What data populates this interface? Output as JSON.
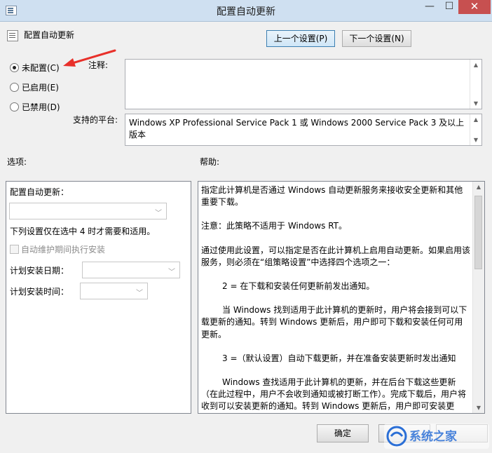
{
  "window": {
    "title": "配置自动更新",
    "close_glyph": "✕",
    "minimize_glyph": "—",
    "maximize_glyph": "☐"
  },
  "header": {
    "policy_name": "配置自动更新",
    "prev_button": "上一个设置(P)",
    "next_button": "下一个设置(N)"
  },
  "state": {
    "options": [
      {
        "label": "未配置(C)",
        "checked": true
      },
      {
        "label": "已启用(E)",
        "checked": false
      },
      {
        "label": "已禁用(D)",
        "checked": false
      }
    ]
  },
  "comment": {
    "label": "注释:",
    "value": ""
  },
  "platform": {
    "label": "支持的平台:",
    "value": "Windows XP Professional Service Pack 1 或 Windows 2000 Service Pack 3 及以上版本"
  },
  "options_panel": {
    "heading": "选项:",
    "configure_label": "配置自动更新：",
    "configure_value": "",
    "note": "下列设置仅在选中 4 时才需要和适用。",
    "maintenance_checkbox": "自动维护期间执行安装",
    "install_day_label": "计划安装日期：",
    "install_day_value": "",
    "install_time_label": "计划安装时间：",
    "install_time_value": ""
  },
  "help_panel": {
    "heading": "帮助:",
    "paragraphs": [
      "指定此计算机是否通过 Windows 自动更新服务来接收安全更新和其他重要下载。",
      "注意：此策略不适用于 Windows RT。",
      "通过使用此设置，可以指定是否在此计算机上启用自动更新。如果启用该服务，则必须在“组策略设置”中选择四个选项之一：",
      "2 = 在下载和安装任何更新前发出通知。",
      "当 Windows 找到适用于此计算机的更新时，用户将会接到可以下载更新的通知。转到 Windows 更新后，用户即可下载和安装任何可用更新。",
      "3 =（默认设置）自动下载更新，并在准备安装更新时发出通知",
      "Windows 查找适用于此计算机的更新，并在后台下载这些更新（在此过程中，用户不会收到通知或被打断工作）。完成下载后，用户将收到可以安装更新的通知。转到 Windows 更新后，用户即可安装更新。"
    ]
  },
  "footer": {
    "ok_button": "确定",
    "watermark_text": "系统之家"
  },
  "colors": {
    "titlebar": "#cfe0f1",
    "close": "#c75050",
    "arrow": "#e8302a"
  }
}
